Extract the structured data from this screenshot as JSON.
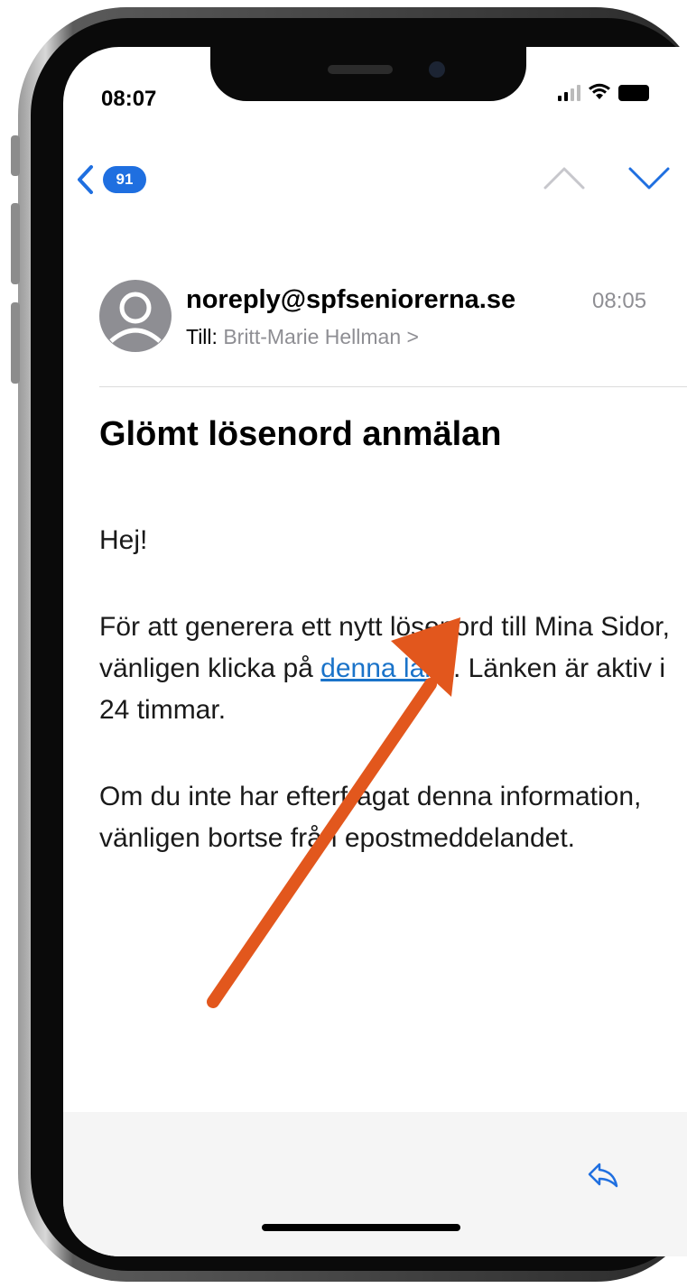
{
  "status_bar": {
    "time": "08:07"
  },
  "nav": {
    "unread_count": "91"
  },
  "email": {
    "sender": "noreply@spfseniorerna.se",
    "time": "08:05",
    "to_label": "Till:",
    "recipient": "Britt-Marie Hellman >",
    "subject": "Glömt lösenord anmälan",
    "greeting": "Hej!",
    "p1_before": "För att generera ett nytt lösenord till Mina Sidor, vänligen klicka på ",
    "link_text": "denna länk",
    "p1_after": ". Länken är aktiv i 24 timmar.",
    "p2": "Om du inte har efterfrågat denna information, vänligen bortse från epostmeddelandet."
  },
  "colors": {
    "accent": "#1f6fe0",
    "link": "#1a73c9",
    "arrow": "#e2571d"
  },
  "icons": [
    "back-chevron-icon",
    "chevron-up-icon",
    "chevron-down-icon",
    "avatar-icon",
    "reply-icon",
    "wifi-icon",
    "battery-icon",
    "signal-icon"
  ]
}
